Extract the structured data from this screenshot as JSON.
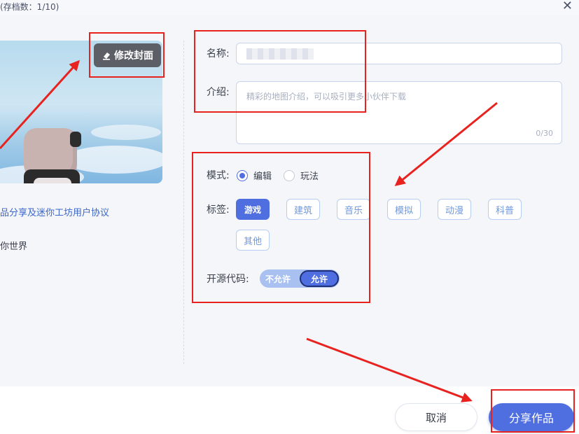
{
  "dialog": {
    "title": "(存档数：1/10)",
    "close_symbol": "✕"
  },
  "cover": {
    "edit_label": "修改封面"
  },
  "left": {
    "agreement_text": "品分享及迷你工坊用户协议",
    "world_text": "你世界"
  },
  "form": {
    "name_label": "名称:",
    "intro_label": "介绍:",
    "intro_placeholder": "精彩的地图介绍，可以吸引更多小伙伴下载",
    "intro_count": "0/30",
    "mode_label": "模式:",
    "mode_options": [
      {
        "label": "编辑",
        "selected": true
      },
      {
        "label": "玩法",
        "selected": false
      }
    ],
    "tags_label": "标签:",
    "tags": [
      {
        "label": "游戏",
        "selected": true
      },
      {
        "label": "建筑",
        "selected": false
      },
      {
        "label": "音乐",
        "selected": false
      },
      {
        "label": "模拟",
        "selected": false
      },
      {
        "label": "动漫",
        "selected": false
      },
      {
        "label": "科普",
        "selected": false
      },
      {
        "label": "其他",
        "selected": false
      }
    ],
    "opensource_label": "开源代码:",
    "opensource_off": "不允许",
    "opensource_on": "允许",
    "opensource_value": "允许"
  },
  "buttons": {
    "cancel": "取消",
    "share": "分享作品"
  },
  "colors": {
    "accent": "#4f6fe0",
    "annotation_red": "#e8231f",
    "link_blue": "#3c66c8"
  }
}
